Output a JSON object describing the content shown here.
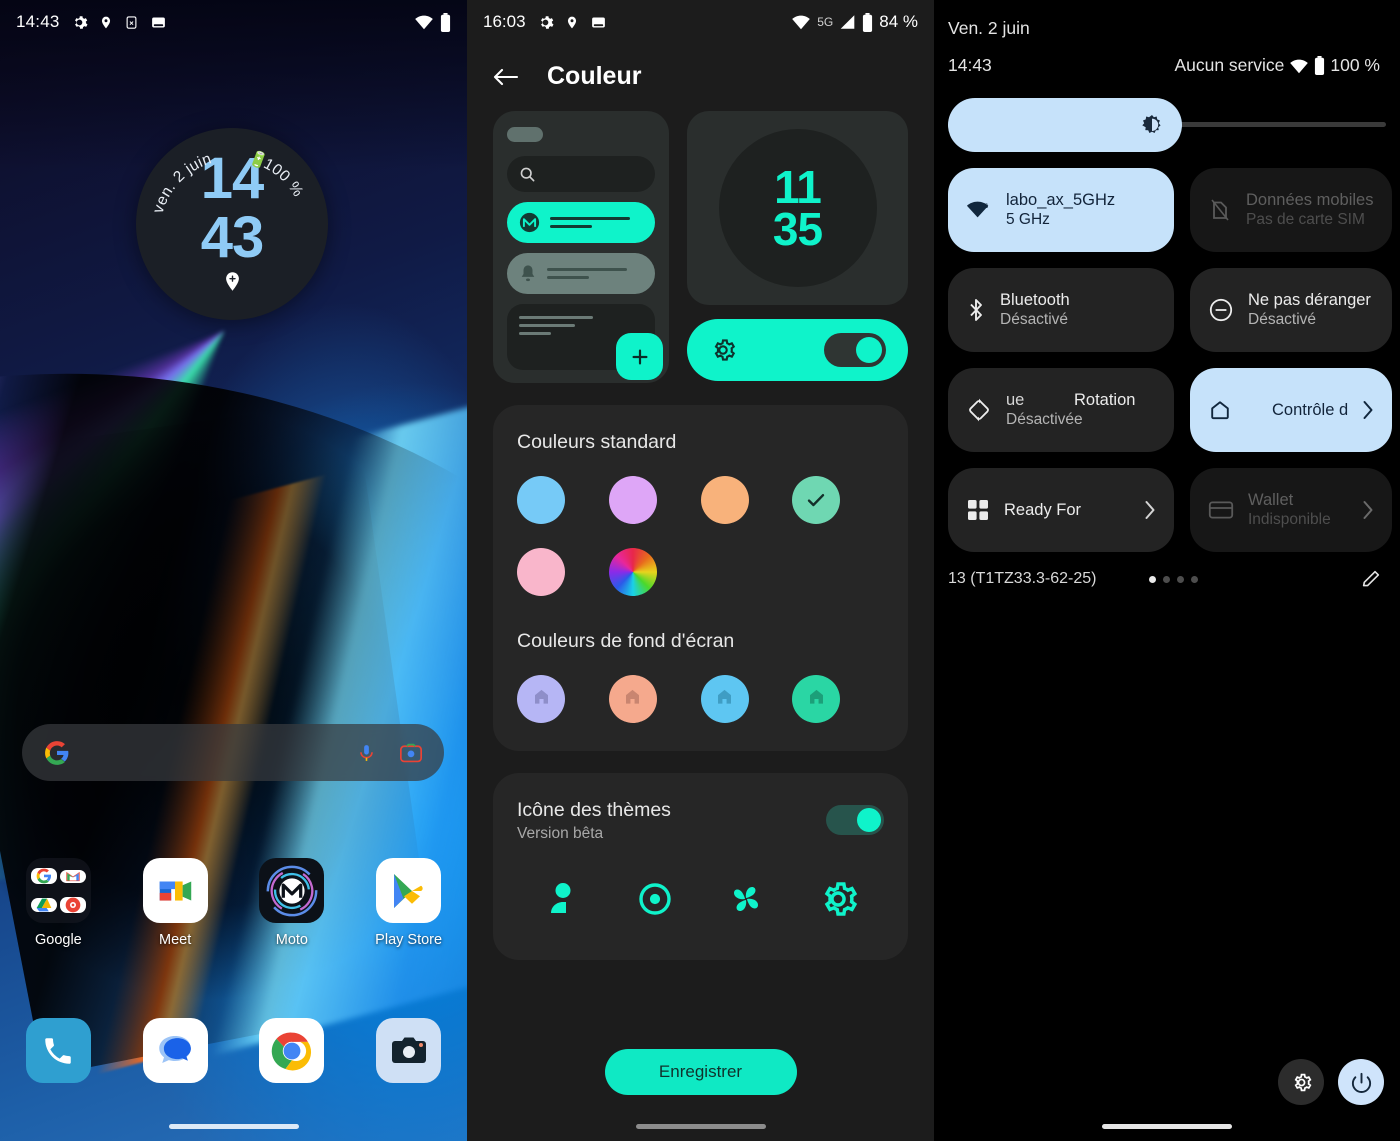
{
  "home": {
    "statusbar": {
      "time": "14:43",
      "icons_left": [
        "gear-icon",
        "location-pin-icon",
        "sim-off-icon",
        "device-icon"
      ],
      "icons_right": [
        "wifi-icon",
        "battery-full-icon"
      ]
    },
    "clock_widget": {
      "date": "ven. 2 juin",
      "battery": "100 %",
      "hours": "14",
      "minutes": "43",
      "bottom_icon": "location-add-icon"
    },
    "search": {
      "logo": "google-g-icon",
      "placeholder": "",
      "mic_icon": "microphone-icon",
      "lens_icon": "google-lens-icon"
    },
    "apps_row1": [
      {
        "label": "Google",
        "icon": "google-folder-icon"
      },
      {
        "label": "Meet",
        "icon": "google-meet-icon"
      },
      {
        "label": "Moto",
        "icon": "moto-icon"
      },
      {
        "label": "Play Store",
        "icon": "google-play-icon"
      }
    ],
    "apps_row2": [
      {
        "label": "",
        "icon": "phone-icon"
      },
      {
        "label": "",
        "icon": "messages-icon"
      },
      {
        "label": "",
        "icon": "chrome-icon"
      },
      {
        "label": "",
        "icon": "camera-icon"
      }
    ]
  },
  "colour": {
    "statusbar": {
      "time": "16:03",
      "network": "5G",
      "battery": "84 %",
      "icons_left": [
        "gear-icon",
        "location-pin-icon",
        "device-icon"
      ],
      "icons_right": [
        "wifi-icon",
        "signal-icon",
        "battery-icon"
      ]
    },
    "header": {
      "back_icon": "arrow-back-icon",
      "title": "Couleur"
    },
    "preview": {
      "clock": {
        "hours": "11",
        "minutes": "35"
      },
      "search_icon": "search-icon",
      "accent_icon": "moto-logo-icon",
      "bell_icon": "bell-icon",
      "fab_icon": "plus-icon",
      "toggle_gear_icon": "gear-icon",
      "toggle_state": "on",
      "accent_color": "#0ff3ca"
    },
    "standard_colors": {
      "title": "Couleurs standard",
      "swatches": [
        {
          "name": "blue",
          "hex": "#76caf7",
          "selected": false
        },
        {
          "name": "violet",
          "hex": "#dea6f7",
          "selected": false
        },
        {
          "name": "orange",
          "hex": "#f8b27b",
          "selected": false
        },
        {
          "name": "teal",
          "hex": "#6fd7b2",
          "selected": true
        },
        {
          "name": "pink",
          "hex": "#f9b6cb",
          "selected": false
        },
        {
          "name": "custom-wheel",
          "hex": "multi",
          "selected": false
        }
      ],
      "check_icon": "check-icon"
    },
    "wallpaper_colors": {
      "title": "Couleurs de fond d'écran",
      "swatches": [
        {
          "name": "lavender",
          "hex": "#b6b6f5",
          "icon": "home-icon"
        },
        {
          "name": "salmon",
          "hex": "#f5a98d",
          "icon": "home-icon"
        },
        {
          "name": "sky",
          "hex": "#5ec6f2",
          "icon": "home-icon"
        },
        {
          "name": "emerald",
          "hex": "#2ad6a4",
          "icon": "home-icon"
        }
      ]
    },
    "themed_icons": {
      "title": "Icône des thèmes",
      "subtitle": "Version bêta",
      "toggle_state": "on",
      "icons": [
        "contact-person-icon",
        "camera-target-icon",
        "pinwheel-icon",
        "gear-icon"
      ]
    },
    "save_button": "Enregistrer"
  },
  "quicksettings": {
    "date": "Ven. 2 juin",
    "time": "14:43",
    "carrier": "Aucun service",
    "battery": "100 %",
    "brightness": {
      "icon": "brightness-icon",
      "value_percent": 52
    },
    "tiles": [
      {
        "id": "wifi",
        "title": "labo_ax_5GHz",
        "subtitle": "5 GHz",
        "icon": "wifi-icon",
        "state": "active",
        "chevron": false
      },
      {
        "id": "data",
        "title": "Données mobiles",
        "subtitle": "Pas de carte SIM",
        "icon": "sim-off-icon",
        "state": "disabled",
        "chevron": false
      },
      {
        "id": "bt",
        "title": "Bluetooth",
        "subtitle": "Désactivé",
        "icon": "bluetooth-icon",
        "state": "off",
        "chevron": false
      },
      {
        "id": "dnd",
        "title": "Ne pas déranger",
        "subtitle": "Désactivé",
        "icon": "do-not-disturb-icon",
        "state": "off",
        "chevron": false
      },
      {
        "id": "rot",
        "title": "Rotation",
        "subtitle": "Désactivée",
        "icon": "rotation-icon",
        "state": "off",
        "chevron": false,
        "ghost_title": "ue"
      },
      {
        "id": "home",
        "title": "Contrôle d",
        "subtitle": "",
        "icon": "home-icon",
        "state": "active",
        "chevron": true
      },
      {
        "id": "ready",
        "title": "Ready For",
        "subtitle": "",
        "icon": "grid-icon",
        "state": "off",
        "chevron": true
      },
      {
        "id": "wallet",
        "title": "Wallet",
        "subtitle": "Indisponible",
        "icon": "card-icon",
        "state": "disabled",
        "chevron": true
      }
    ],
    "footer": {
      "build": "13 (T1TZ33.3-62-25)",
      "pages": 4,
      "active_page": 1,
      "edit_icon": "pencil-icon"
    },
    "bottom_buttons": [
      {
        "name": "settings-button",
        "icon": "gear-icon",
        "style": "dark"
      },
      {
        "name": "power-button",
        "icon": "power-icon",
        "style": "light"
      }
    ]
  }
}
